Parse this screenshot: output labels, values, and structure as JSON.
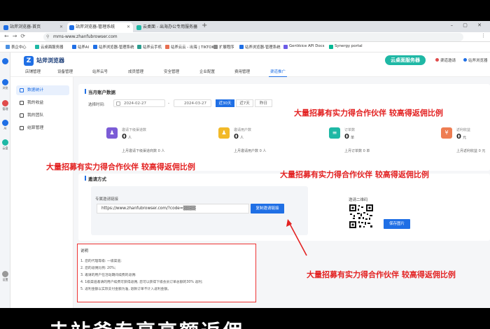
{
  "browser": {
    "tabs": [
      {
        "label": "站斧浏览器-首页",
        "color": "#1f6fe5"
      },
      {
        "label": "站斧浏览器-管理系统",
        "color": "#1f6fe5"
      },
      {
        "label": "云桌面 - 出海办公专用服务器",
        "color": "#1fb8a5"
      }
    ],
    "new_tab": "+",
    "window_controls": "– ▢ ✕",
    "url": "mms-www.zhanfubrowser.com",
    "bookmarks": [
      {
        "label": "表企中心",
        "color": "#4a90e2"
      },
      {
        "label": "云桌面服务器",
        "color": "#1fb8a5"
      },
      {
        "label": "站斧AI",
        "color": "#1f6fe5"
      },
      {
        "label": "站斧浏览器-管理系统",
        "color": "#1f6fe5"
      },
      {
        "label": "站斧云手机",
        "color": "#2a9d8f"
      },
      {
        "label": "站斧云云 - 出海 | TIKTOK...",
        "color": "#e76f51"
      },
      {
        "label": "扩展程序",
        "color": "#888888"
      },
      {
        "label": "站斧浏览器-管理系统",
        "color": "#1f6fe5"
      },
      {
        "label": "GenVoice API Docs",
        "color": "#6c5ce7"
      },
      {
        "label": "Synergy portal",
        "color": "#00b894"
      }
    ]
  },
  "app": {
    "logo_text": "站斧浏览器",
    "cloud_button": "云桌面服务器",
    "header_right": [
      "渠道邀请",
      "站斧浏览器"
    ],
    "top_nav": [
      "店铺管理",
      "设备管理",
      "站斧云号",
      "成员管理",
      "安全管理",
      "企业配置",
      "费用管理",
      "渠道推广"
    ],
    "active_nav_index": 7,
    "rail": [
      {
        "label": "浏览",
        "color": "#1f6fe5"
      },
      {
        "label": "管理",
        "color": "#e04b4b"
      },
      {
        "label": "AI",
        "color": "#1f6fe5"
      },
      {
        "label": "云盘",
        "color": "#1fb8a5"
      },
      {
        "label": "设置",
        "color": "#999999"
      }
    ],
    "sidebar": [
      {
        "label": "数据统计",
        "active": true
      },
      {
        "label": "我的收益",
        "active": false
      },
      {
        "label": "我的团队",
        "active": false
      },
      {
        "label": "结算管理",
        "active": false
      }
    ]
  },
  "stats_section": {
    "title": "当月账户数据",
    "date_label": "选择时间:",
    "date_from": "2024-02-27",
    "date_sep": "-",
    "date_to": "2024-03-27",
    "ranges": [
      "近30天",
      "近7天",
      "昨日"
    ],
    "active_range": 0,
    "cards": [
      {
        "caption": "邀请下级渠道数",
        "value": "0",
        "unit": "人",
        "sub": "上月邀请下级渠道商数 0 人",
        "icon_color": "#7b5cd6",
        "icon": "♟"
      },
      {
        "caption": "邀请用户数",
        "value": "0",
        "unit": "人",
        "sub": "上月邀请用户数 0 人",
        "icon_color": "#f2b928",
        "icon": "♟"
      },
      {
        "caption": "订单数",
        "value": "0",
        "unit": "单",
        "sub": "上月订单数 0 单",
        "icon_color": "#1fb8a5",
        "icon": "≡"
      },
      {
        "caption": "返利收益",
        "value": "0",
        "unit": "元",
        "sub": "上月返利收益 0 元",
        "icon_color": "#ee7d52",
        "icon": "¥"
      }
    ]
  },
  "invite_section": {
    "title": "邀请方式",
    "link_label": "专属邀请链接",
    "link_value": "https://www.zhanfubrowser.com/?code=▒▒▒▒",
    "copy_button": "复制邀请链接",
    "qr_label": "邀请二维码",
    "save_button": "保存图片"
  },
  "notes": {
    "title": "说明",
    "lines": [
      "1. 您的代理等级: 一级渠道;",
      "2. 您的返佣比例: 20%;",
      "3. 邀请的用户在活动期间续费的返佣:",
      "4. 1级渠道邀请的用户续费可获得返佣, 您可以获得下级会员订单总额的30% 返利;",
      "5. 返利金额以实际支付金额为准, 退款订单不计入返利金额。"
    ]
  },
  "overlays": [
    "大量招募有实力得合作伙伴 较高得返佣比例",
    "大量招募有实力得合作伙伴 较高得返佣比例",
    "大量招募有实力得合作伙伴 较高得返佣比例",
    "大量招募有实力得合作伙伴 较高得返佣比例"
  ],
  "bottom_caption": "去站斧专享高额返佣",
  "colors": {
    "accent": "#1f6fe5",
    "overlay_red": "#e32222",
    "cloud_green": "#1fb8a5"
  }
}
